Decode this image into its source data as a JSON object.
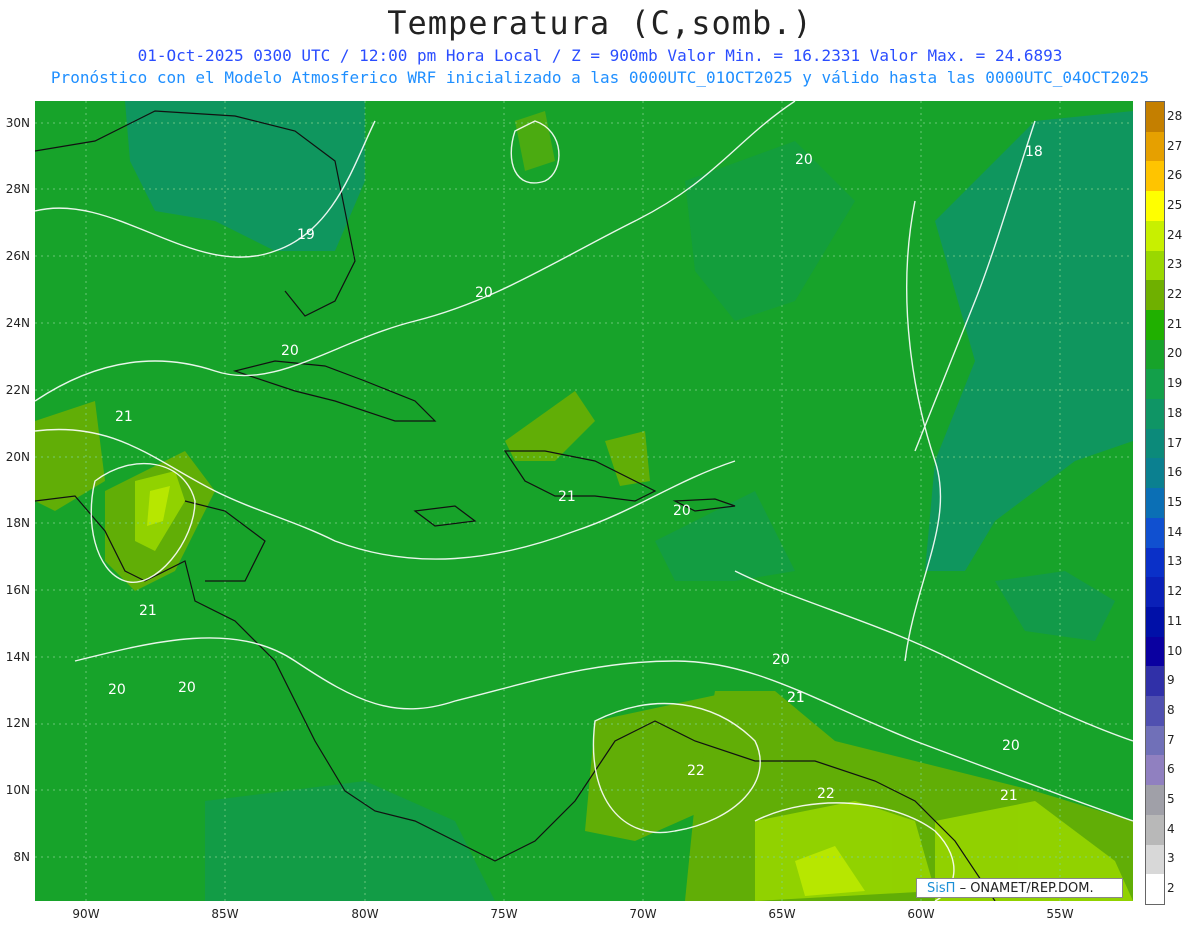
{
  "header": {
    "title": "Temperatura (C,somb.)",
    "subtitle_line1": "01-Oct-2025  0300 UTC / 12:00 pm Hora Local / Z = 900mb   Valor Min. = 16.2331  Valor Max. = 24.6893",
    "subtitle_line2": "Pronóstico con el Modelo Atmosferico WRF inicializado a las 0000UTC_01OCT2025 y válido hasta las  0000UTC_04OCT2025"
  },
  "axes": {
    "lat_labels": [
      "30N",
      "28N",
      "26N",
      "24N",
      "22N",
      "20N",
      "18N",
      "16N",
      "14N",
      "12N",
      "10N",
      "8N"
    ],
    "lon_labels": [
      "90W",
      "85W",
      "80W",
      "75W",
      "70W",
      "65W",
      "60W",
      "55W"
    ]
  },
  "contour_labels": [
    "19",
    "20",
    "20",
    "18",
    "20",
    "21",
    "21",
    "21",
    "20",
    "21",
    "20",
    "20",
    "20",
    "21",
    "20",
    "22",
    "22",
    "21"
  ],
  "colorbar": {
    "levels": [
      "28",
      "27",
      "26",
      "25",
      "24",
      "23",
      "22",
      "21",
      "20",
      "19",
      "18",
      "17",
      "16",
      "15",
      "14",
      "13",
      "12",
      "11",
      "10",
      "9",
      "8",
      "7",
      "6",
      "5",
      "4",
      "3",
      "2"
    ],
    "colors": [
      "#c47f00",
      "#e6a000",
      "#ffc400",
      "#ffff00",
      "#c8f000",
      "#9ad800",
      "#6fb000",
      "#20b000",
      "#17a32a",
      "#13a04a",
      "#0f9565",
      "#0c8a7a",
      "#0b8090",
      "#0b6fb5",
      "#1050d0",
      "#0a30c8",
      "#0a20b8",
      "#0010a8",
      "#0a00a0",
      "#3030a8",
      "#5050b0",
      "#7070b8",
      "#9080c0",
      "#a0a0a8",
      "#b8b8b8",
      "#d8d8d8",
      "#ffffff"
    ]
  },
  "credit": {
    "brand": "SisΠ",
    "text": "– ONAMET/REP.DOM."
  }
}
